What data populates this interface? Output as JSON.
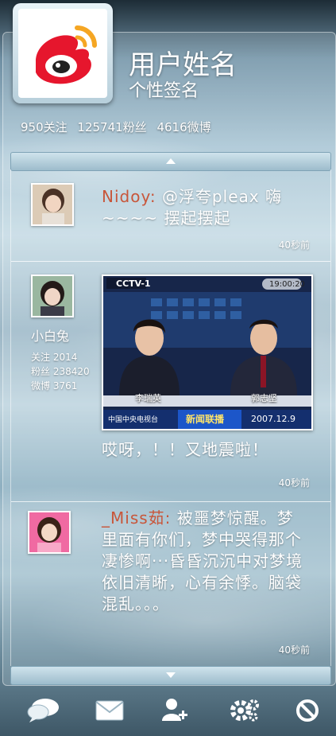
{
  "profile": {
    "username": "用户姓名",
    "signature": "个性签名",
    "following": "950关注",
    "followers": "125741粉丝",
    "posts": "4616微博"
  },
  "feed": [
    {
      "nickname": "Nidoy:",
      "text": "@浮夸pleax 嗨~~~~ 摆起摆起",
      "time": "40秒前"
    },
    {
      "poster_name": "小白兔",
      "poster_following": "关注 2014",
      "poster_followers": "粉丝 238420",
      "poster_posts": "微博 3761",
      "photo": {
        "channel": "CCTV-1",
        "clock": "19:00:20",
        "anchor_left": "李瑞英",
        "anchor_right": "郭志坚",
        "station": "中国中央电视台",
        "program": "新闻联播",
        "date": "2007.12.9"
      },
      "text": "哎呀，！！又地震啦！",
      "time": "40秒前"
    },
    {
      "nickname": "_Miss茹:",
      "text": "被噩梦惊醒。梦里面有你们，梦中哭得那个凄惨啊···昏昏沉沉中对梦境依旧清晰，心有余悸。脑袋混乱。。。",
      "time": "40秒前"
    }
  ],
  "toolbar": {
    "icons": [
      "comments-icon",
      "mail-icon",
      "add-user-icon",
      "settings-icon",
      "block-icon"
    ]
  },
  "colors": {
    "nickname": "#c8563a",
    "logo_red": "#e6162d",
    "logo_orange": "#f5a623"
  }
}
